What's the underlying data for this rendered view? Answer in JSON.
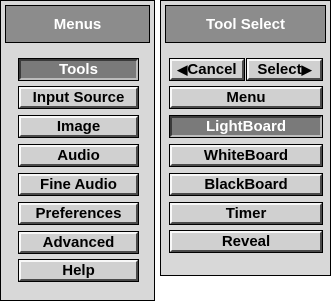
{
  "menus": {
    "title": "Menus",
    "items": [
      {
        "label": "Tools",
        "active": true
      },
      {
        "label": "Input Source",
        "active": false
      },
      {
        "label": "Image",
        "active": false
      },
      {
        "label": "Audio",
        "active": false
      },
      {
        "label": "Fine Audio",
        "active": false
      },
      {
        "label": "Preferences",
        "active": false
      },
      {
        "label": "Advanced",
        "active": false
      },
      {
        "label": "Help",
        "active": false
      }
    ]
  },
  "tool_select": {
    "title": "Tool Select",
    "cancel_label": "Cancel",
    "cancel_icon": "left-arrow-icon",
    "select_label": "Select",
    "select_icon": "right-arrow-icon",
    "items": [
      {
        "label": "Menu",
        "active": false
      },
      {
        "label": "LightBoard",
        "active": true
      },
      {
        "label": "WhiteBoard",
        "active": false
      },
      {
        "label": "BlackBoard",
        "active": false
      },
      {
        "label": "Timer",
        "active": false
      },
      {
        "label": "Reveal",
        "active": false
      }
    ]
  },
  "colors": {
    "panel": "#d8d8d8",
    "header": "#8c8c8c",
    "button": "#d0d0d0",
    "active_button": "#7a7a7a"
  }
}
